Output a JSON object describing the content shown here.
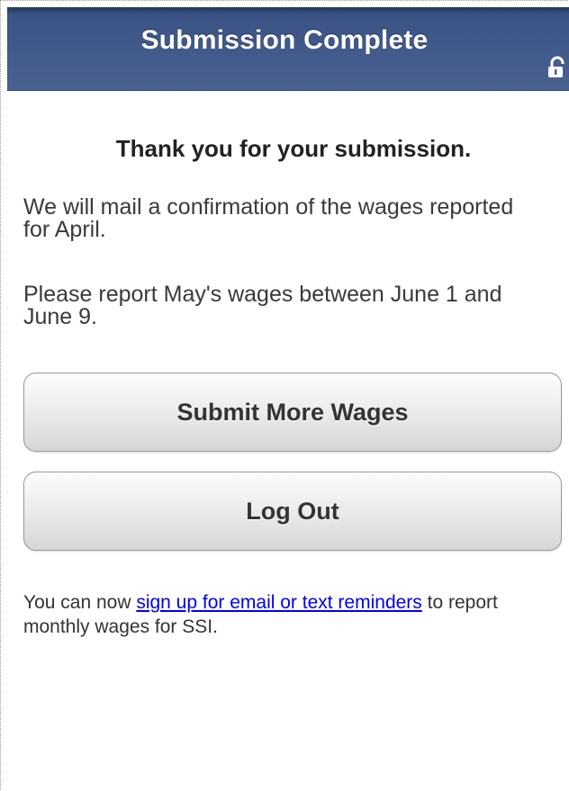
{
  "header": {
    "title": "Submission Complete",
    "lock_icon": "unlock-icon"
  },
  "main": {
    "thanks": "Thank you for your submission.",
    "para1": "We will mail a confirmation of the wages reported for April.",
    "para2": "Please report May's wages between June 1 and June 9.",
    "buttons": {
      "submit_more": "Submit More Wages",
      "log_out": "Log Out"
    },
    "note": {
      "prefix": "You can now ",
      "link": "sign up for email or text reminders",
      "suffix": " to report monthly wages for SSI."
    }
  },
  "colors": {
    "header_bg": "#4a6191",
    "link": "#0000ee"
  }
}
